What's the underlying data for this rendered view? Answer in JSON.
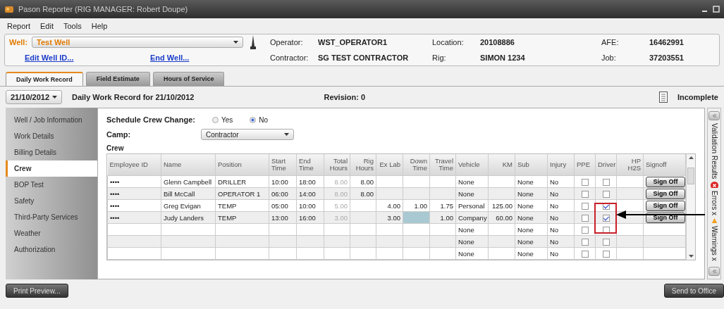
{
  "window": {
    "title": "Pason Reporter (RIG MANAGER: Robert Doupe)"
  },
  "menu": [
    "Report",
    "Edit",
    "Tools",
    "Help"
  ],
  "well": {
    "label": "Well:",
    "value": "Test Well",
    "links": [
      "Edit Well ID...",
      "End Well..."
    ],
    "fields": [
      {
        "label": "Operator:",
        "value": "WST_OPERATOR1"
      },
      {
        "label": "Location:",
        "value": "20108886"
      },
      {
        "label": "AFE:",
        "value": "16462991"
      },
      {
        "label": "Contractor:",
        "value": "SG TEST CONTRACTOR"
      },
      {
        "label": "Rig:",
        "value": "SIMON 1234"
      },
      {
        "label": "Job:",
        "value": "37203551"
      }
    ]
  },
  "tabs": [
    {
      "label": "Daily Work Record",
      "selected": true
    },
    {
      "label": "Field Estimate",
      "selected": false
    },
    {
      "label": "Hours of Service",
      "selected": false
    }
  ],
  "date": "21/10/2012",
  "record_title": "Daily Work Record for 21/10/2012",
  "revision": "Revision: 0",
  "status": "Incomplete",
  "sidebar": {
    "items": [
      {
        "label": "Well / Job Information",
        "selected": false
      },
      {
        "label": "Work Details",
        "selected": false
      },
      {
        "label": "Billing Details",
        "selected": false
      },
      {
        "label": "Crew",
        "selected": true
      },
      {
        "label": "BOP Test",
        "selected": false
      },
      {
        "label": "Safety",
        "selected": false
      },
      {
        "label": "Third-Party Services",
        "selected": false
      },
      {
        "label": "Weather",
        "selected": false
      },
      {
        "label": "Authorization",
        "selected": false
      }
    ]
  },
  "crew_change": {
    "label": "Schedule Crew Change:",
    "options": [
      {
        "label": "Yes",
        "selected": false
      },
      {
        "label": "No",
        "selected": true
      }
    ]
  },
  "camp": {
    "label": "Camp:",
    "value": "Contractor"
  },
  "section_title": "Crew",
  "table": {
    "columns": [
      "Employee ID",
      "Name",
      "Position",
      "Start Time",
      "End Time",
      "Total Hours",
      "Rig Hours",
      "Ex Lab",
      "Down Time",
      "Travel Time",
      "Vehicle",
      "KM",
      "Sub",
      "Injury",
      "PPE",
      "Driver",
      "HP H2S",
      "Signoff"
    ],
    "rows": [
      {
        "cells": [
          "••••",
          "Glenn Campbell",
          "DRILLER",
          "10:00",
          "18:00",
          "8.00",
          "8.00",
          null,
          null,
          null,
          "None",
          null,
          "None",
          "No"
        ],
        "ppe": false,
        "driver": false,
        "signoff": "Sign Off"
      },
      {
        "cells": [
          "••••",
          "Bill McCall",
          "OPERATOR 1",
          "06:00",
          "14:00",
          "8.00",
          "8.00",
          null,
          null,
          null,
          "None",
          null,
          "None",
          "No"
        ],
        "ppe": false,
        "driver": false,
        "signoff": "Sign Off"
      },
      {
        "cells": [
          "••••",
          "Greg Evigan",
          "TEMP",
          "05:00",
          "10:00",
          "5.00",
          null,
          "4.00",
          "1.00",
          "1.75",
          "Personal",
          "125.00",
          "None",
          "No"
        ],
        "ppe": false,
        "driver": true,
        "signoff": "Sign Off"
      },
      {
        "cells": [
          "••••",
          "Judy Landers",
          "TEMP",
          "13:00",
          "16:00",
          "3.00",
          null,
          "3.00",
          {
            "selected": true
          },
          "1.00",
          "Company",
          "60.00",
          "None",
          "No"
        ],
        "ppe": false,
        "driver": true,
        "signoff": "Sign Off"
      },
      {
        "cells": [
          null,
          null,
          null,
          null,
          null,
          null,
          null,
          null,
          null,
          null,
          "None",
          null,
          "None",
          "No"
        ],
        "ppe": false,
        "driver": false
      },
      {
        "cells": [
          null,
          null,
          null,
          null,
          null,
          null,
          null,
          null,
          null,
          null,
          "None",
          null,
          "None",
          "No"
        ],
        "ppe": false,
        "driver": false
      },
      {
        "cells": [
          null,
          null,
          null,
          null,
          null,
          null,
          null,
          null,
          null,
          null,
          "None",
          null,
          "None",
          "No"
        ],
        "ppe": false,
        "driver": false
      }
    ]
  },
  "validation": {
    "title": "Validation Results",
    "errors": "Errors x",
    "warnings": "Warnings x"
  },
  "buttons": {
    "left": "Print Preview...",
    "right": "Send to Office"
  }
}
